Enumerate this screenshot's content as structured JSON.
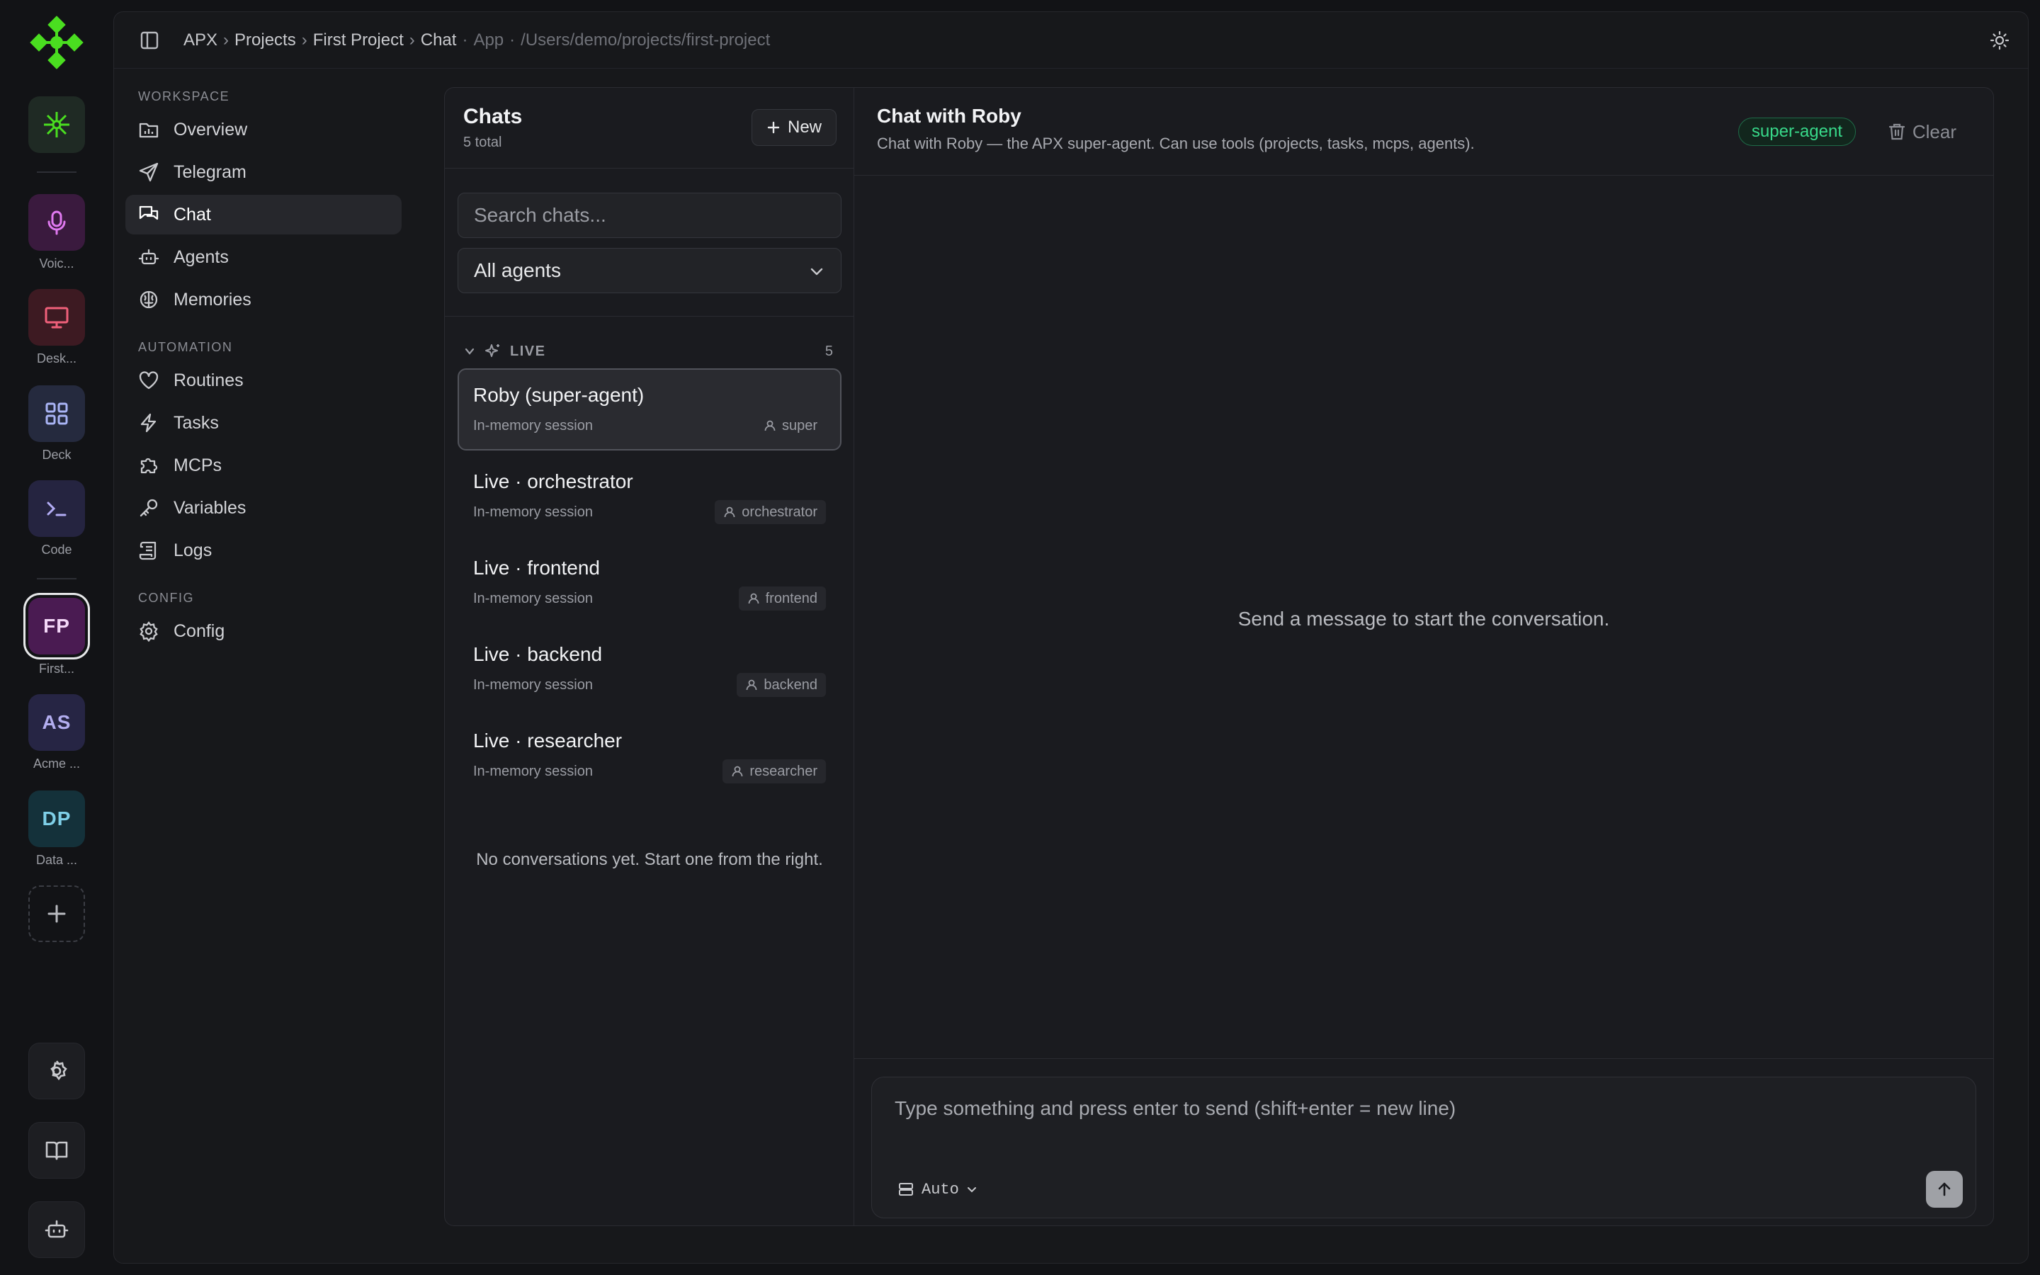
{
  "rail": {
    "apps": [
      {
        "label": "Voic...",
        "icon": "microphone-icon"
      },
      {
        "label": "Desk...",
        "icon": "monitor-icon"
      },
      {
        "label": "Deck",
        "icon": "grid-icon"
      },
      {
        "label": "Code",
        "icon": "terminal-icon"
      }
    ],
    "projects": [
      {
        "initials": "FP",
        "label": "First..."
      },
      {
        "initials": "AS",
        "label": "Acme ..."
      },
      {
        "initials": "DP",
        "label": "Data ..."
      }
    ]
  },
  "breadcrumb": {
    "items": [
      "APX",
      "Projects",
      "First Project",
      "Chat"
    ],
    "context": "App",
    "path": "/Users/demo/projects/first-project"
  },
  "nav": {
    "sections": [
      {
        "title": "WORKSPACE",
        "items": [
          "Overview",
          "Telegram",
          "Chat",
          "Agents",
          "Memories"
        ]
      },
      {
        "title": "AUTOMATION",
        "items": [
          "Routines",
          "Tasks",
          "MCPs",
          "Variables",
          "Logs"
        ]
      },
      {
        "title": "CONFIG",
        "items": [
          "Config"
        ]
      }
    ],
    "active": "Chat"
  },
  "chatlist": {
    "title": "Chats",
    "subtitle": "5 total",
    "new_label": "New",
    "search_placeholder": "Search chats...",
    "agent_filter": "All agents",
    "group": {
      "label": "LIVE",
      "count": "5"
    },
    "items": [
      {
        "title": "Roby (super-agent)",
        "subtitle": "In-memory session",
        "agent": "super"
      },
      {
        "title": "Live · orchestrator",
        "subtitle": "In-memory session",
        "agent": "orchestrator"
      },
      {
        "title": "Live · frontend",
        "subtitle": "In-memory session",
        "agent": "frontend"
      },
      {
        "title": "Live · backend",
        "subtitle": "In-memory session",
        "agent": "backend"
      },
      {
        "title": "Live · researcher",
        "subtitle": "In-memory session",
        "agent": "researcher"
      }
    ],
    "empty": "No conversations yet. Start one from the right."
  },
  "conversation": {
    "title": "Chat with Roby",
    "subtitle": "Chat with Roby — the APX super-agent. Can use tools (projects, tasks, mcps, agents).",
    "agent_badge": "super-agent",
    "clear_label": "Clear",
    "empty": "Send a message to start the conversation.",
    "composer_placeholder": "Type something and press enter to send (shift+enter = new line)",
    "model": "Auto"
  },
  "colors": {
    "accent_green": "#38d98a",
    "logo_green": "#4ade20",
    "background": "#121316"
  }
}
